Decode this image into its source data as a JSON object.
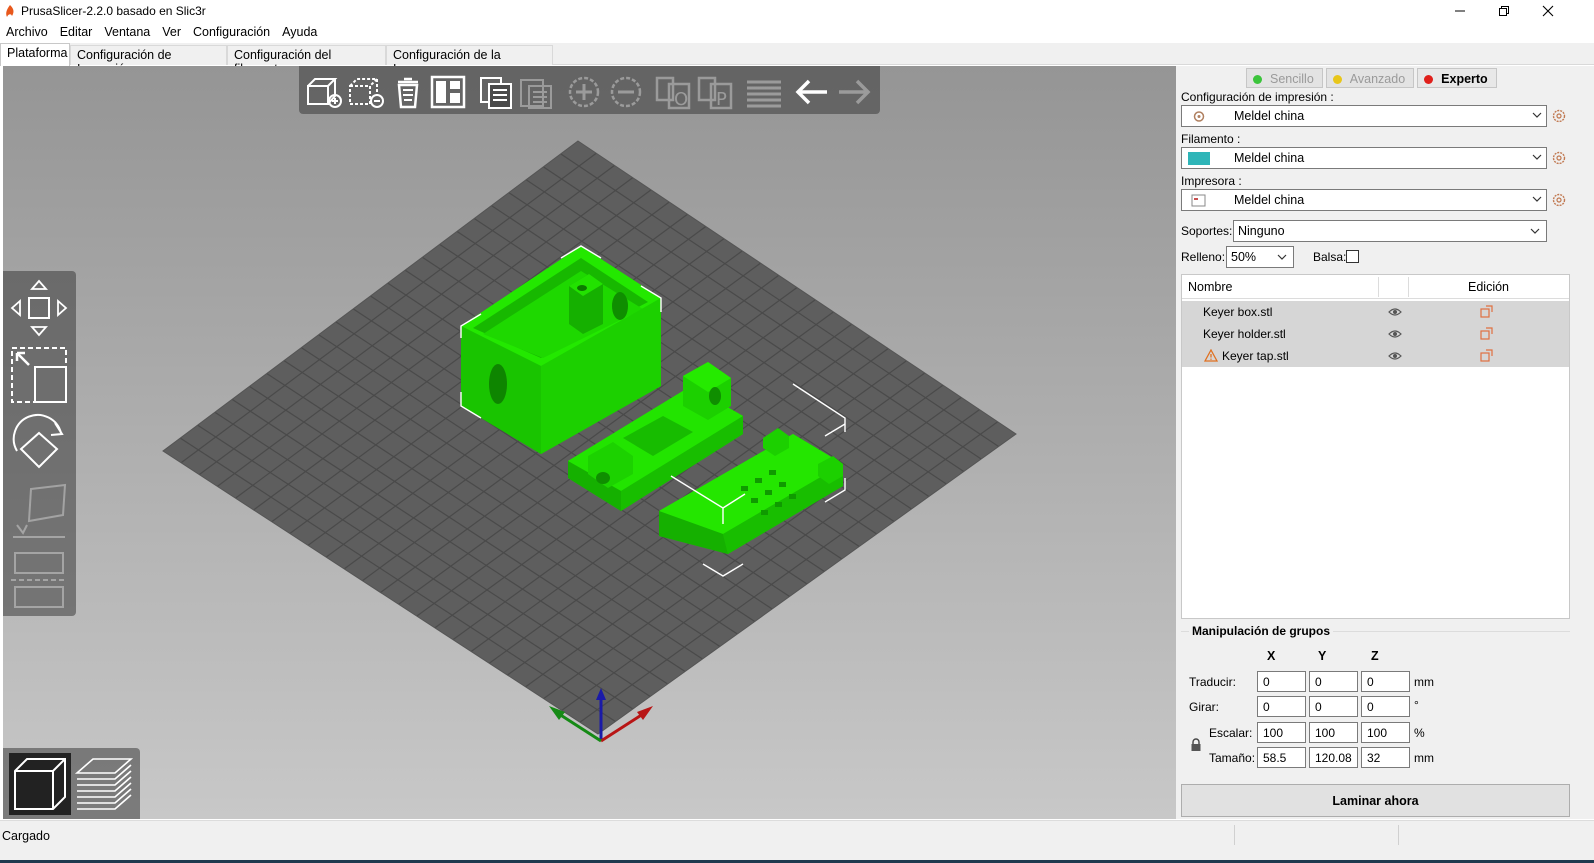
{
  "window": {
    "title": "PrusaSlicer-2.2.0 basado en Slic3r",
    "minimize_icon": "minimize-icon",
    "restore_icon": "restore-icon",
    "close_icon": "close-icon"
  },
  "menu": [
    "Archivo",
    "Editar",
    "Ventana",
    "Ver",
    "Configuración",
    "Ayuda"
  ],
  "tabs": [
    "Plataforma",
    "Configuración de Impresión",
    "Configuración del filamento",
    "Configuración de la Impresora"
  ],
  "viewport": {
    "top_toolbar_icons": [
      "add-icon",
      "delete-icon",
      "delete-all-icon",
      "arrange-icon",
      "copy-icon",
      "paste-icon",
      "add-instance-icon",
      "remove-instance-icon",
      "split-objects-icon",
      "split-parts-icon",
      "layers-editing-icon",
      "undo-icon",
      "redo-icon"
    ],
    "left_toolbar_icons": [
      "move-icon",
      "scale-icon",
      "rotate-icon",
      "place-on-face-icon",
      "cut-icon"
    ],
    "view_icons": [
      "3d-view-icon",
      "preview-layers-icon"
    ],
    "model_color": "#1edb00",
    "bed_color": "#606060"
  },
  "panel": {
    "modes": [
      {
        "label": "Sencillo",
        "color": "#3bc43b",
        "active": false
      },
      {
        "label": "Avanzado",
        "color": "#e8c61a",
        "active": false
      },
      {
        "label": "Experto",
        "color": "#e0201b",
        "active": true
      }
    ],
    "print_label": "Configuración de impresión :",
    "print_value": "Meldel china",
    "filament_label": "Filamento :",
    "filament_value": "Meldel china",
    "filament_color": "#2eb5b8",
    "printer_label": "Impresora :",
    "printer_value": "Meldel china",
    "supports_label": "Soportes:",
    "supports_value": "Ninguno",
    "infill_label": "Relleno:",
    "infill_value": "50%",
    "brim_label": "Balsa:",
    "object_list": {
      "col_name": "Nombre",
      "col_edit": "Edición",
      "items": [
        {
          "name": "Keyer box.stl",
          "warning": false
        },
        {
          "name": "Keyer holder.stl",
          "warning": false
        },
        {
          "name": "Keyer tap.stl",
          "warning": true
        }
      ]
    },
    "manipulation": {
      "title": "Manipulación de grupos",
      "axes": [
        "X",
        "Y",
        "Z"
      ],
      "translate_label": "Traducir:",
      "translate": [
        "0",
        "0",
        "0"
      ],
      "translate_unit": "mm",
      "rotate_label": "Girar:",
      "rotate": [
        "0",
        "0",
        "0"
      ],
      "rotate_unit": "°",
      "scale_label": "Escalar:",
      "scale": [
        "100",
        "100",
        "100"
      ],
      "scale_unit": "%",
      "size_label": "Tamaño:",
      "size": [
        "58.5",
        "120.08",
        "32"
      ],
      "size_unit": "mm"
    },
    "slice_button": "Laminar ahora"
  },
  "status": {
    "text": "Cargado"
  }
}
